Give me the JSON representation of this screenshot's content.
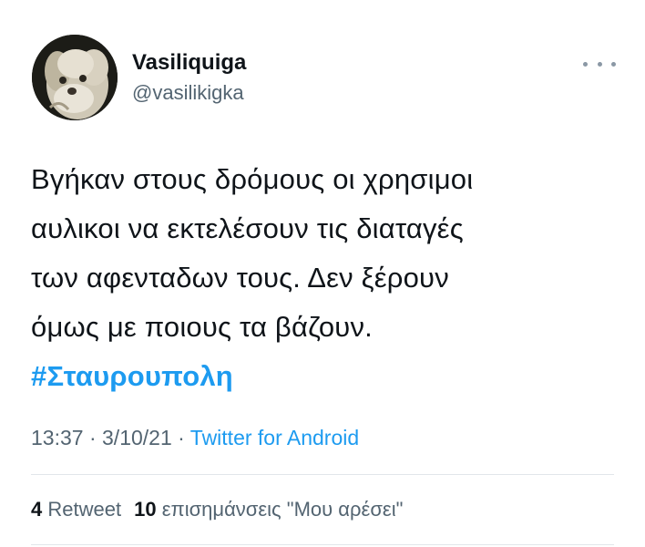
{
  "user": {
    "display_name": "Vasiliquiga",
    "handle": "@vasilikigka",
    "avatar_icon": "dog-avatar-icon"
  },
  "more_icon": "more-dots-icon",
  "tweet": {
    "text_lines": [
      "Βγήκαν στους δρόμους οι χρησιμοι",
      "αυλικοι να εκτελέσουν τις διαταγές",
      "των αφενταδων τους. Δεν ξέρουν",
      "όμως με ποιους τα βάζουν."
    ],
    "hashtag": "#Σταυρουπολη"
  },
  "meta": {
    "time": "13:37",
    "separator1": " · ",
    "date": "3/10/21",
    "separator2": " · ",
    "source": "Twitter for Android"
  },
  "stats": {
    "retweet_count": "4",
    "retweet_label": "Retweet",
    "like_count": "10",
    "like_label": "επισημάνσεις \"Μου αρέσει\""
  },
  "colors": {
    "link": "#1d9bf0",
    "text": "#0f1419",
    "secondary": "#536471",
    "divider": "#e1e6ea"
  }
}
